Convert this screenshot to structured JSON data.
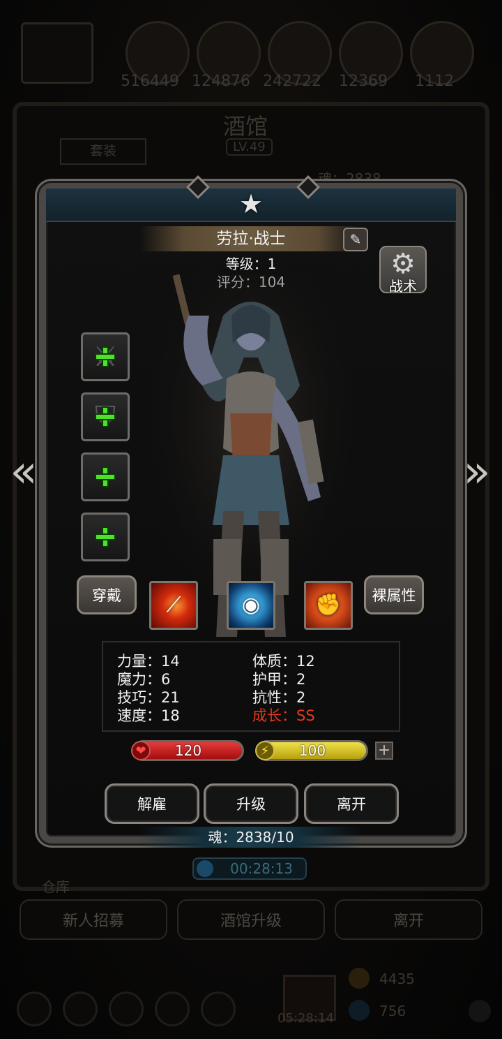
{
  "background": {
    "resources": [
      "516449",
      "124876",
      "242722",
      "12369",
      "1112"
    ],
    "tavern_title": "酒馆",
    "tavern_level": "LV.49",
    "set_tab": "套装",
    "souls_label": "魂：2838",
    "warehouse_label": "仓库",
    "buttons": {
      "recruit": "新人招募",
      "upgrade_tavern": "酒馆升级",
      "leave": "离开"
    },
    "timer_bottom": "05:28:14",
    "gold": "4435",
    "gems": "756"
  },
  "hero": {
    "name": "劳拉·战士",
    "level_line": "等级：1",
    "score_line": "评分：104",
    "tactics_label": "战术"
  },
  "buttons": {
    "equip": "穿戴",
    "base_attributes": "裸属性",
    "dismiss": "解雇",
    "upgrade": "升级",
    "leave": "离开"
  },
  "stats": {
    "left": [
      "力量：14",
      "魔力：6",
      "技巧：21",
      "速度：18"
    ],
    "right": [
      "体质：12",
      "护甲：2",
      "抗性：2"
    ],
    "growth": "成长：SS"
  },
  "bars": {
    "hp": "120",
    "energy": "100"
  },
  "souls": "魂：2838/10",
  "timer": "00:28:13",
  "icons": {
    "slots": [
      "weapon-slot-icon",
      "armor-slot-icon",
      "accessory-slot-icon",
      "accessory-slot-icon"
    ],
    "skills": [
      "slash-skill-icon",
      "eye-skill-icon",
      "fist-skill-icon"
    ]
  },
  "colors": {
    "growth": "#e5391e",
    "hp": "#c81a1a",
    "energy": "#d8c62a",
    "plus": "#4ee02a"
  }
}
